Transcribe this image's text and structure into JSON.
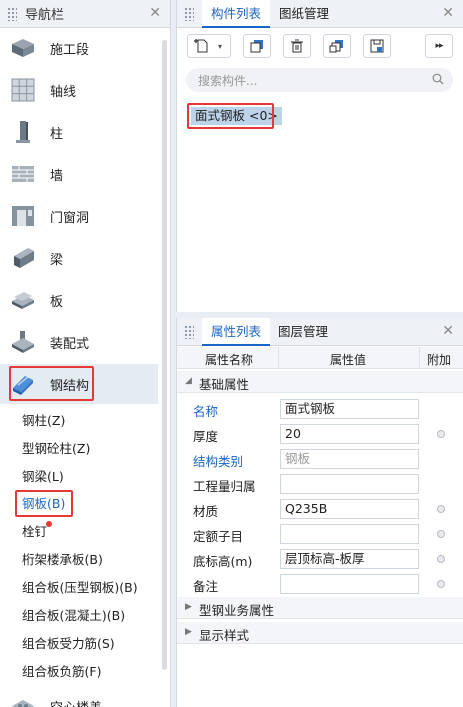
{
  "nav": {
    "title": "导航栏",
    "items": [
      {
        "label": "施工段",
        "icon": "construction-section-icon"
      },
      {
        "label": "轴线",
        "icon": "grid-axis-icon"
      },
      {
        "label": "柱",
        "icon": "column-icon"
      },
      {
        "label": "墙",
        "icon": "wall-icon"
      },
      {
        "label": "门窗洞",
        "icon": "door-window-icon"
      },
      {
        "label": "梁",
        "icon": "beam-icon"
      },
      {
        "label": "板",
        "icon": "slab-icon"
      },
      {
        "label": "装配式",
        "icon": "prefab-icon"
      },
      {
        "label": "钢结构",
        "icon": "steel-structure-icon"
      },
      {
        "label": "空心楼盖",
        "icon": "hollow-floor-icon"
      }
    ],
    "steel_sub_items": [
      {
        "label": "钢柱(Z)"
      },
      {
        "label": "型钢砼柱(Z)"
      },
      {
        "label": "钢梁(L)"
      },
      {
        "label": "钢板(B)"
      },
      {
        "label": "栓钉"
      },
      {
        "label": "桁架楼承板(B)"
      },
      {
        "label": "组合板(压型钢板)(B)"
      },
      {
        "label": "组合板(混凝土)(B)"
      },
      {
        "label": "组合板受力筋(S)"
      },
      {
        "label": "组合板负筋(F)"
      }
    ],
    "active_item": "钢结构",
    "selected_sub_item": "钢板(B)"
  },
  "component_panel": {
    "tabs": [
      {
        "label": "构件列表"
      },
      {
        "label": "图纸管理"
      }
    ],
    "search_placeholder": "搜索构件...",
    "items": [
      {
        "label": "面式钢板 <0>"
      }
    ]
  },
  "property_panel": {
    "tabs": [
      {
        "label": "属性列表"
      },
      {
        "label": "图层管理"
      }
    ],
    "columns": {
      "name": "属性名称",
      "value": "属性值",
      "extra": "附加"
    },
    "group_basic": "基础属性",
    "rows": [
      {
        "name": "名称",
        "value": "面式钢板"
      },
      {
        "name": "厚度",
        "value": "20"
      },
      {
        "name": "结构类别",
        "value": "钢板"
      },
      {
        "name": "工程量归属",
        "value": ""
      },
      {
        "name": "材质",
        "value": "Q235B"
      },
      {
        "name": "定额子目",
        "value": ""
      },
      {
        "name": "底标高(m)",
        "value": "层顶标高-板厚"
      },
      {
        "name": "备注",
        "value": ""
      }
    ],
    "group_steel": "型钢业务属性",
    "group_display": "显示样式"
  },
  "colors": {
    "accent": "#1a66c9",
    "highlight_box": "#e53935",
    "selection": "#bcd3ea"
  }
}
